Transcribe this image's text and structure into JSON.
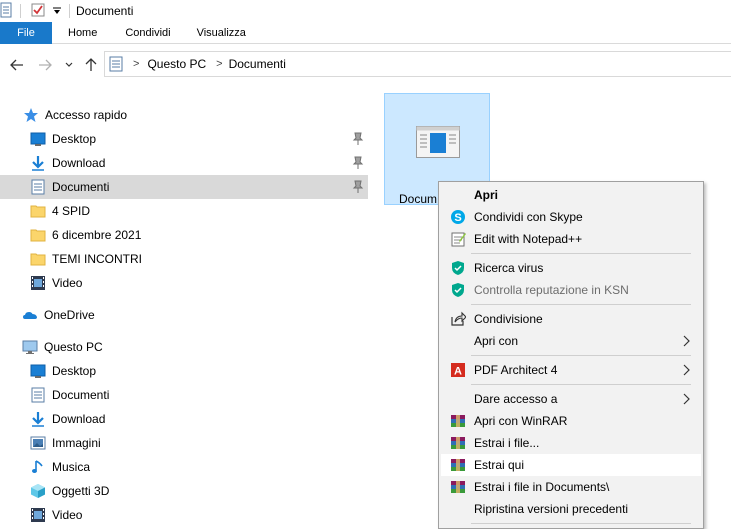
{
  "window": {
    "title": "Documenti"
  },
  "ribbon": {
    "tabs": [
      "File",
      "Home",
      "Condividi",
      "Visualizza"
    ]
  },
  "address": {
    "crumbs": [
      "Questo PC",
      "Documenti"
    ]
  },
  "nav": {
    "quick_access": "Accesso rapido",
    "quick_items": [
      "Desktop",
      "Download",
      "Documenti",
      "4 SPID",
      "6 dicembre 2021",
      "TEMI INCONTRI",
      "Video"
    ],
    "onedrive": "OneDrive",
    "this_pc": "Questo PC",
    "pc_items": [
      "Desktop",
      "Documenti",
      "Download",
      "Immagini",
      "Musica",
      "Oggetti 3D",
      "Video"
    ]
  },
  "content": {
    "file_label": "Docum"
  },
  "context_menu": {
    "items": [
      {
        "label": "Apri",
        "icon": "none"
      },
      {
        "label": "Condividi con Skype",
        "icon": "skype-icon"
      },
      {
        "label": "Edit with Notepad++",
        "icon": "notepadpp-icon"
      },
      {
        "label": "Ricerca virus",
        "icon": "kaspersky-shield-icon"
      },
      {
        "label": "Controlla reputazione in KSN",
        "icon": "kaspersky-shield-icon"
      },
      {
        "label": "Condivisione",
        "icon": "share-icon"
      },
      {
        "label": "Apri con",
        "icon": "none"
      },
      {
        "label": "PDF Architect 4",
        "icon": "pdf-architect-icon"
      },
      {
        "label": "Dare accesso a",
        "icon": "none"
      },
      {
        "label": "Apri con WinRAR",
        "icon": "winrar-icon"
      },
      {
        "label": "Estrai i file...",
        "icon": "winrar-icon"
      },
      {
        "label": "Estrai qui",
        "icon": "winrar-icon"
      },
      {
        "label": "Estrai i file in Documents\\",
        "icon": "winrar-icon"
      },
      {
        "label": "Ripristina versioni precedenti",
        "icon": "none"
      }
    ]
  },
  "colors": {
    "file_tab": "#1979ca",
    "selection": "#cce8ff",
    "nav_selected": "#d9d9d9",
    "menu_bg": "#f2f2f2"
  }
}
